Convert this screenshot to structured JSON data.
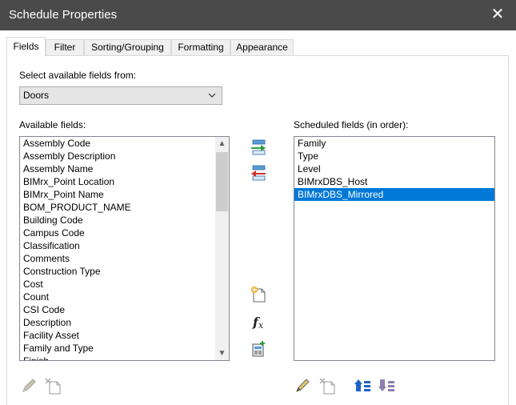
{
  "window": {
    "title": "Schedule Properties",
    "close_glyph": "✕"
  },
  "tabs": [
    {
      "label": "Fields"
    },
    {
      "label": "Filter"
    },
    {
      "label": "Sorting/Grouping"
    },
    {
      "label": "Formatting"
    },
    {
      "label": "Appearance"
    }
  ],
  "select_label": "Select available fields from:",
  "select_value": "Doors",
  "available_label": "Available fields:",
  "available_fields": [
    "Assembly Code",
    "Assembly Description",
    "Assembly Name",
    "BIMrx_Point Location",
    "BIMrx_Point Name",
    "BOM_PRODUCT_NAME",
    "Building Code",
    "Campus Code",
    "Classification",
    "Comments",
    "Construction Type",
    "Cost",
    "Count",
    "CSI Code",
    "Description",
    "Facility Asset",
    "Family and Type",
    "Finish"
  ],
  "scheduled_label": "Scheduled fields (in order):",
  "scheduled_fields": [
    "Family",
    "Type",
    "Level",
    "BIMrxDBS_Host",
    "BIMrxDBS_Mirrored"
  ],
  "selected_scheduled": "BIMrxDBS_Mirrored",
  "colors": {
    "titlebar": "#4a4a4a",
    "selection": "#0078d7",
    "add_green": "#2e9e3e",
    "remove_red": "#d32f2f",
    "accent_blue": "#1e63c4"
  },
  "icons": {
    "add": "add-field-icon",
    "remove": "remove-field-icon",
    "add_parameter": "add-parameter-icon",
    "calculated": "calculated-value-icon",
    "combine": "combine-parameters-icon",
    "edit": "edit-pencil-icon",
    "delete": "delete-parameter-icon",
    "move_up": "move-up-icon",
    "move_down": "move-down-icon"
  }
}
